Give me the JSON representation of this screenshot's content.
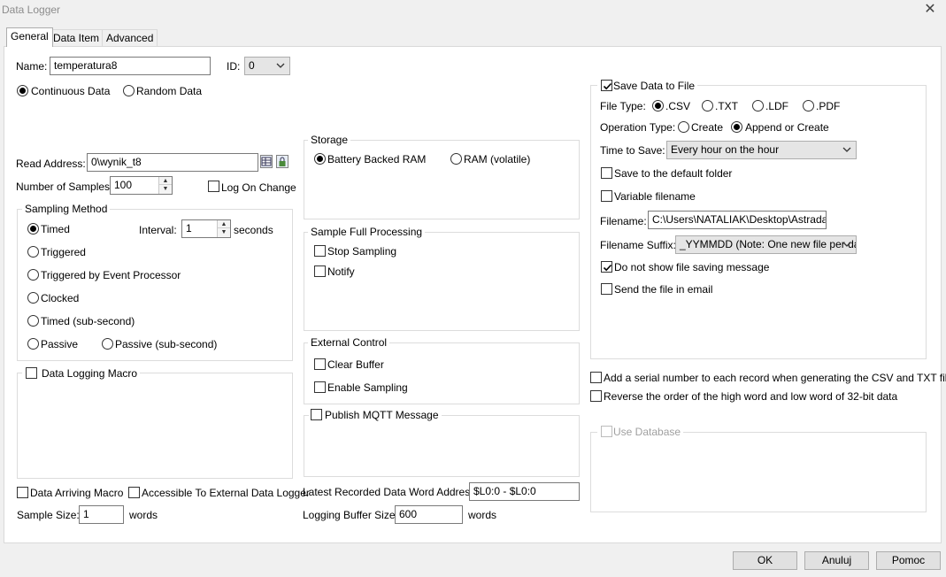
{
  "window": {
    "title": "Data Logger"
  },
  "tabs": [
    "General",
    "Data Item",
    "Advanced"
  ],
  "name": {
    "label": "Name:",
    "value": "temperatura8"
  },
  "id": {
    "label": "ID:",
    "value": "0"
  },
  "data_mode": {
    "continuous": "Continuous Data",
    "random": "Random Data",
    "selected": "continuous"
  },
  "read_address": {
    "label": "Read Address:",
    "value": "0\\wynik_t8"
  },
  "num_samples": {
    "label": "Number of Samples:",
    "value": "100"
  },
  "log_on_change": {
    "label": "Log On Change",
    "checked": false
  },
  "sampling_method": {
    "legend": "Sampling Method",
    "options": [
      "Timed",
      "Triggered",
      "Triggered by Event Processor",
      "Clocked",
      "Timed (sub-second)",
      "Passive",
      "Passive (sub-second)"
    ],
    "selected": "Timed",
    "interval_label": "Interval:",
    "interval_value": "1",
    "interval_unit": "seconds"
  },
  "data_logging_macro": {
    "label": "Data Logging Macro",
    "checked": false
  },
  "data_arriving_macro": {
    "label": "Data Arriving Macro",
    "checked": false
  },
  "accessible_external": {
    "label": "Accessible To External Data Logger",
    "checked": false
  },
  "sample_size": {
    "label": "Sample Size:",
    "value": "1",
    "unit": "words"
  },
  "storage": {
    "legend": "Storage",
    "battery": "Battery Backed RAM",
    "ram": "RAM (volatile)",
    "selected": "battery"
  },
  "sample_full": {
    "legend": "Sample Full Processing",
    "stop": "Stop Sampling",
    "notify": "Notify"
  },
  "external_control": {
    "legend": "External Control",
    "clear": "Clear Buffer",
    "enable": "Enable Sampling"
  },
  "mqtt": {
    "label": "Publish MQTT Message",
    "checked": false
  },
  "latest_address": {
    "label": "Latest Recorded Data Word Address:",
    "value": "$L0:0 - $L0:0"
  },
  "buffer_size": {
    "label": "Logging Buffer Size:",
    "value": "600",
    "unit": "words"
  },
  "save_file": {
    "label": "Save Data to File",
    "checked": true,
    "file_type_label": "File Type:",
    "file_types": [
      ".CSV",
      ".TXT",
      ".LDF",
      ".PDF"
    ],
    "file_type_selected": ".CSV",
    "op_type_label": "Operation Type:",
    "op_create": "Create",
    "op_append": "Append or Create",
    "op_selected": "append",
    "time_label": "Time to Save:",
    "time_value": "Every hour on the hour",
    "default_folder": "Save to the default folder",
    "variable_filename": "Variable filename",
    "filename_label": "Filename:",
    "filename_value": "C:\\Users\\NATALIAK\\Desktop\\Astrada\\te",
    "suffix_label": "Filename Suffix:",
    "suffix_value": "_YYMMDD (Note: One new file per day",
    "no_message": "Do not show file saving message",
    "no_message_checked": true,
    "send_email": "Send the file in email"
  },
  "serial_number": {
    "label": "Add a serial number to each record when  generating the CSV and TXT files",
    "checked": false
  },
  "reverse_order": {
    "label": "Reverse the order of the high word and low word of 32-bit data",
    "checked": false
  },
  "use_database": {
    "label": "Use Database",
    "checked": false
  },
  "buttons": {
    "ok": "OK",
    "cancel": "Anuluj",
    "help": "Pomoc"
  }
}
